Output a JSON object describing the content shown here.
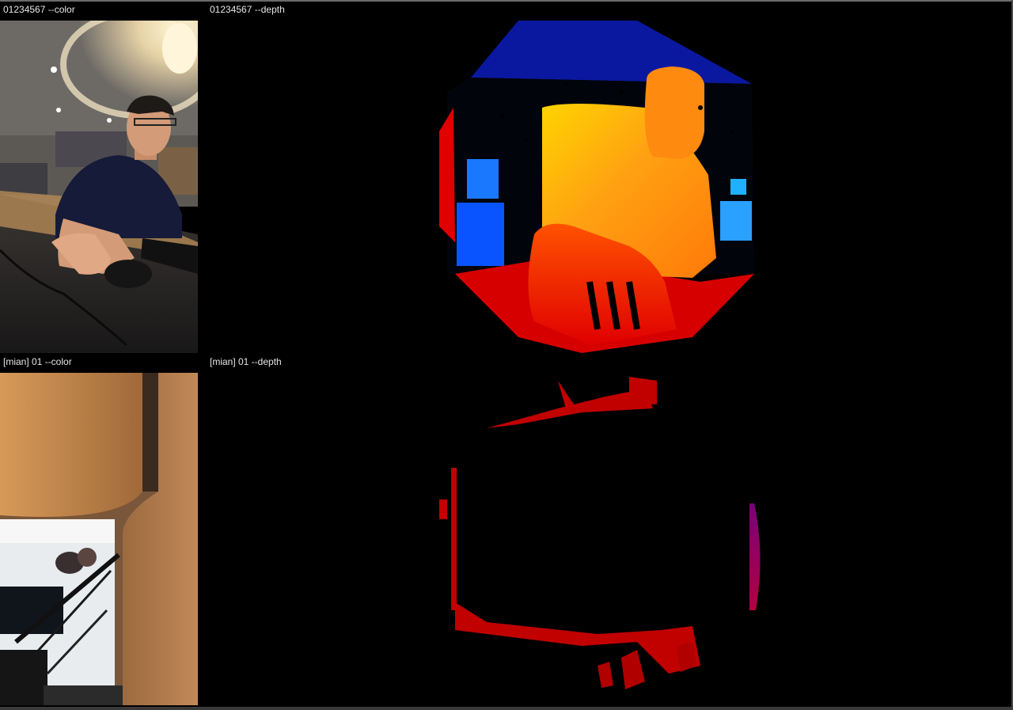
{
  "window": {
    "streams": [
      {
        "id": "cam1-color",
        "label": "01234567 --color"
      },
      {
        "id": "cam1-depth",
        "label": "01234567 --depth"
      },
      {
        "id": "cam2-color",
        "label": "[mian] 01 --color"
      },
      {
        "id": "cam2-depth",
        "label": "[mian] 01 --depth"
      }
    ]
  },
  "colors": {
    "background": "#000000",
    "label_text": "#e6e6e6",
    "depth_near": "#d40000",
    "depth_mid": "#ff9a10",
    "depth_far": "#0a16a0"
  }
}
